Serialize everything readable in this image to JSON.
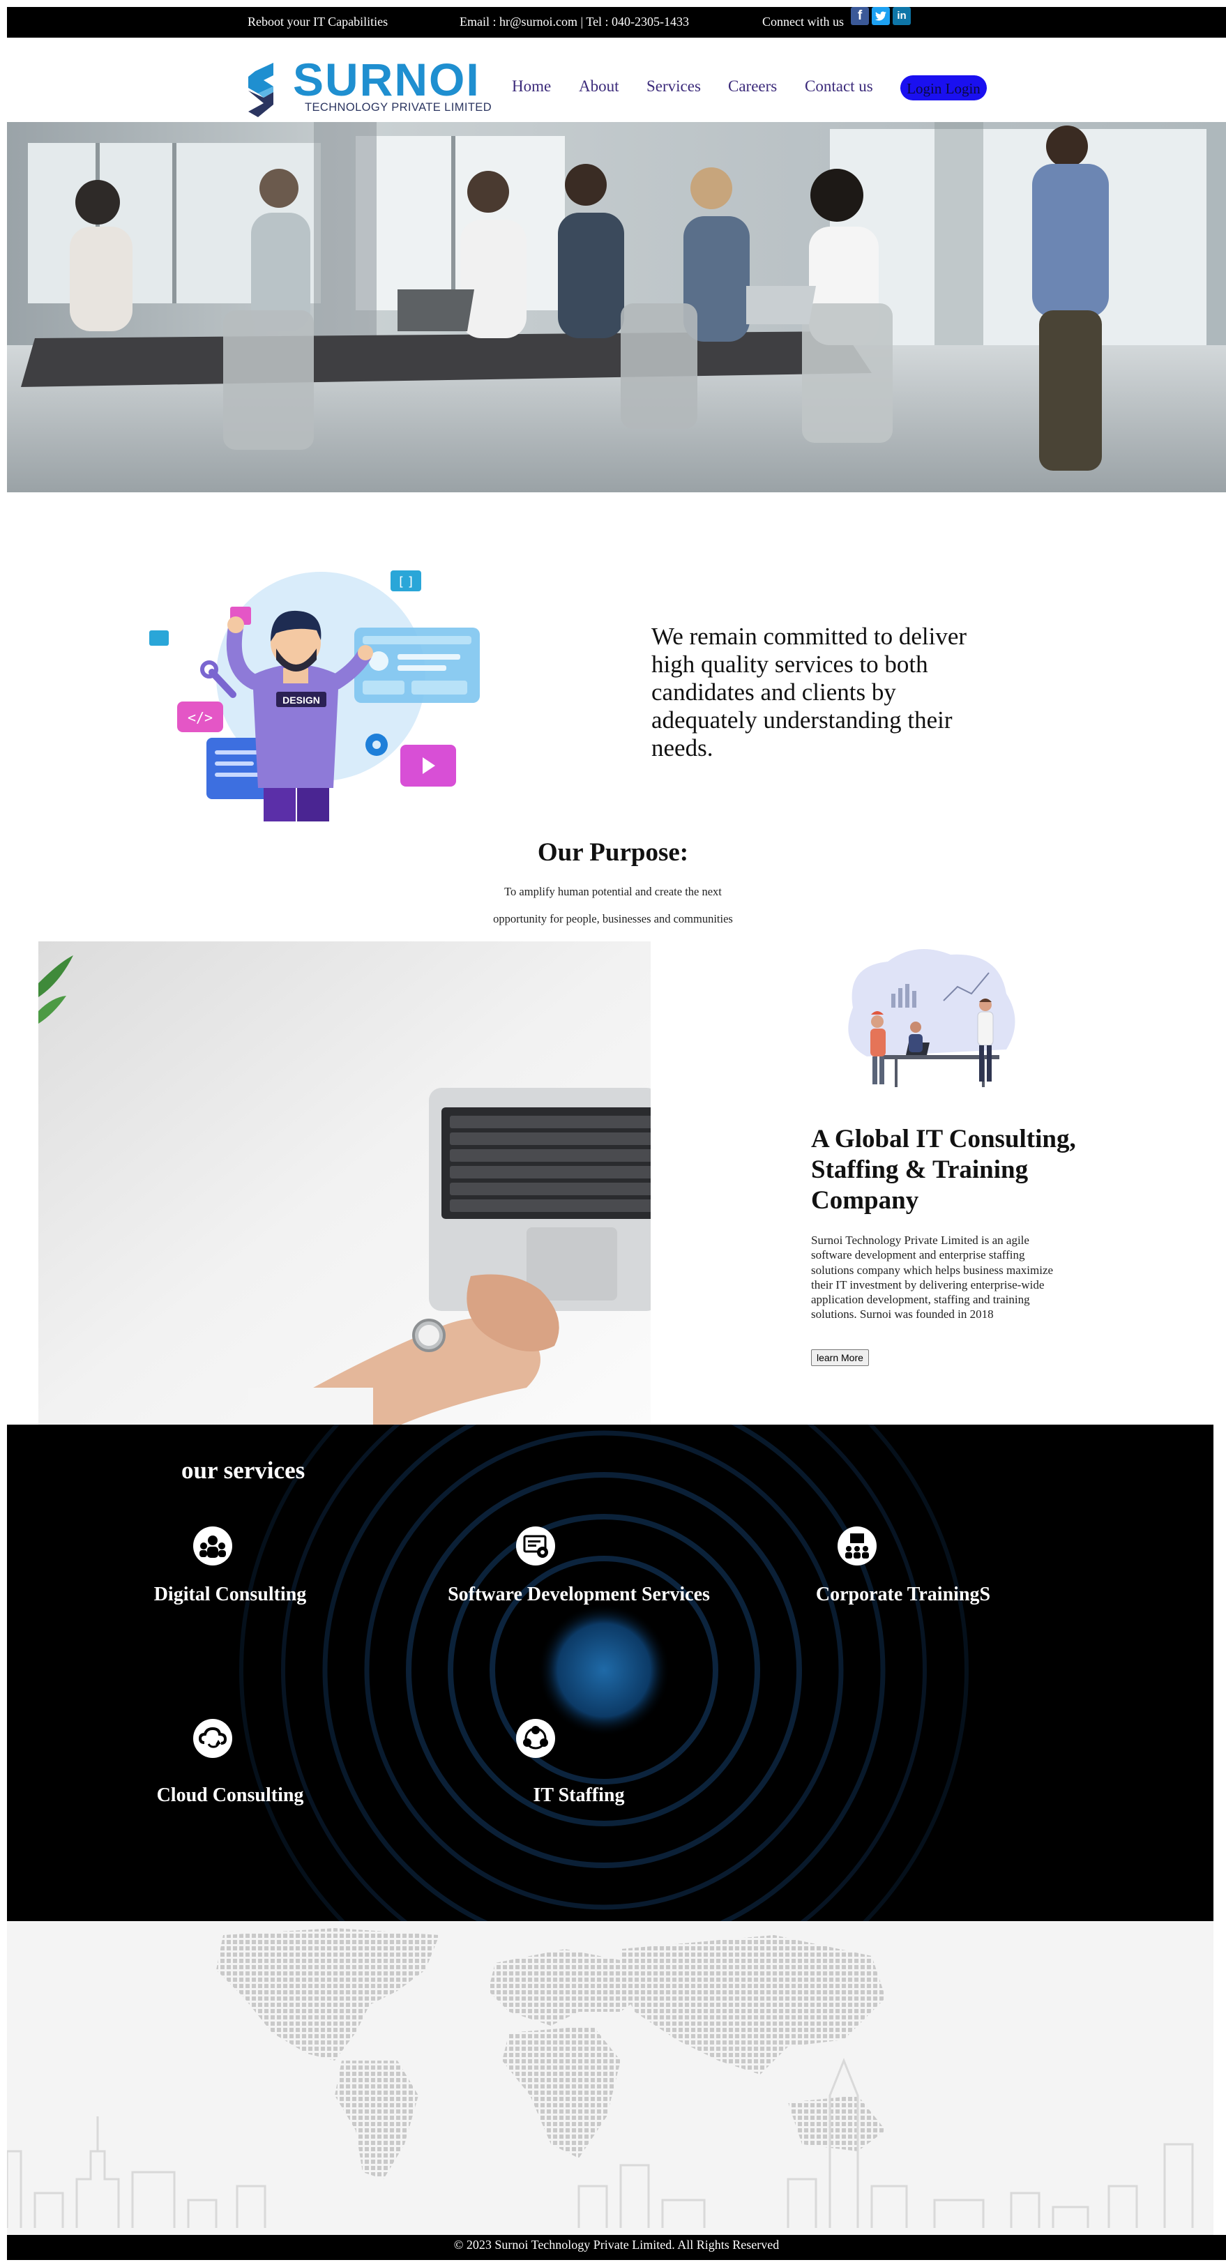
{
  "topbar": {
    "tagline": "Reboot your IT Capabilities",
    "contact": "Email : hr@surnoi.com | Tel : 040-2305-1433",
    "connect": "Connect with us",
    "social": [
      {
        "icon": "facebook-icon",
        "glyph": "f",
        "color": "#3b5998"
      },
      {
        "icon": "twitter-icon",
        "glyph": "t",
        "color": "#1da1f2"
      },
      {
        "icon": "linkedin-icon",
        "glyph": "in",
        "color": "#0e76a8"
      }
    ]
  },
  "header": {
    "logo_word": "SURNOI",
    "logo_sub": "TECHNOLOGY PRIVATE LIMITED",
    "nav": [
      "Home",
      "About",
      "Services",
      "Careers",
      "Contact us"
    ],
    "login": "Login Login",
    "brand_color": "#1f8fd0"
  },
  "commitment": {
    "text": "We remain committed to deliver high quality services to both candidates and clients by adequately understanding their needs.",
    "illustration_badge": "DESIGN"
  },
  "purpose": {
    "title": "Our Purpose:",
    "line1": "To amplify human potential and create the next",
    "line2": "opportunity for people, businesses and communities"
  },
  "company": {
    "title": "A Global IT Consulting, Staffing & Training Company",
    "description": "Surnoi Technology Private Limited is an agile software development and enterprise staffing solutions company which helps business maximize their IT investment by delivering enterprise-wide application development, staffing and training solutions. Surnoi was founded in 2018",
    "cta": "learn More"
  },
  "services": {
    "title": "our services",
    "items": [
      {
        "label": "Digital Consulting",
        "icon": "people-network-icon"
      },
      {
        "label": "Software Development Services",
        "icon": "code-screen-icon"
      },
      {
        "label": "Corporate TrainingS",
        "icon": "training-group-icon"
      },
      {
        "label": "Cloud Consulting",
        "icon": "cloud-sync-icon"
      },
      {
        "label": "IT Staffing",
        "icon": "team-people-icon"
      }
    ]
  },
  "footer": {
    "copyright": "© 2023 Surnoi Technology Private Limited. All Rights Reserved"
  }
}
